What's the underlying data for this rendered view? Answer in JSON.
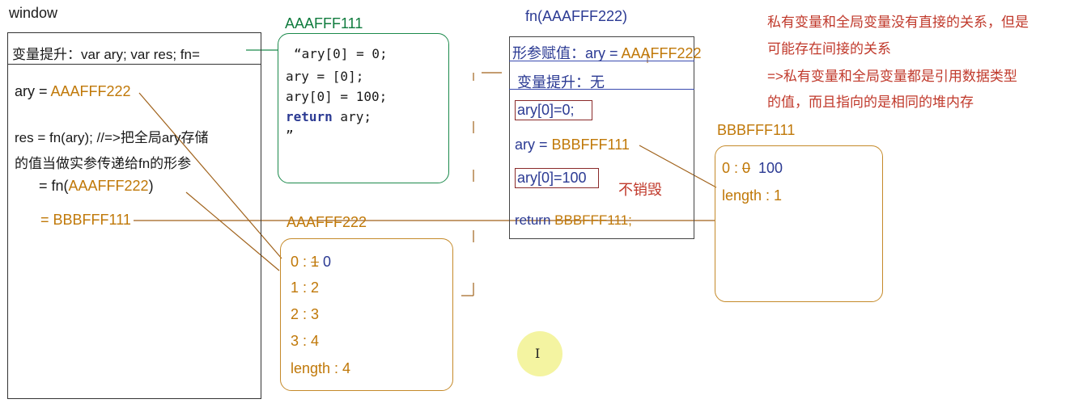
{
  "colors": {
    "orange": "#c07808",
    "blue": "#2b3a93",
    "green": "#0f7b3d",
    "red": "#c0392b",
    "line": "#a0621b"
  },
  "window": {
    "title": "window",
    "hoisting": "变量提升：var ary;  var res;  fn=",
    "ary_label": "ary = ",
    "ary_value": "AAAFFF222",
    "res_line1": "res = fn(ary); //=>把全局ary存储",
    "res_line2": "的值当做实参传递给fn的形参",
    "fn_call_prefix": "= fn(",
    "fn_call_arg": "AAAFFF222",
    "fn_call_suffix": ")",
    "result": "= BBBFFF111"
  },
  "code_heap": {
    "label": "AAAFFF111",
    "lines": [
      "“ary[0] = 0;",
      "ary = [0];",
      "ary[0] = 100;",
      "return ary;",
      "”"
    ],
    "keyword": "return"
  },
  "array_heap": {
    "label": "AAAFFF222",
    "items": [
      {
        "key": "0 : ",
        "old": "1",
        "new": " 0"
      },
      {
        "key": "1 : 2"
      },
      {
        "key": "2 : 3"
      },
      {
        "key": "3 : 4"
      },
      {
        "key": "length : 4"
      }
    ]
  },
  "fn_scope": {
    "label": "fn(AAAFFF222)",
    "param_prefix": "形参赋值：ary = ",
    "param_value": "AAAFFF222",
    "hoisting": "变量提升：无",
    "line1": "ary[0]=0;",
    "line2_prefix": "ary = ",
    "line2_value": "BBBFFF111",
    "line3": "ary[0]=100",
    "not_destroyed": "不销毁",
    "return_prefix": "return ",
    "return_value": "BBBFFF111;"
  },
  "new_heap": {
    "label": "BBBFFF111",
    "item0_key": "0 : ",
    "item0_old": "0",
    "item0_new": "  100",
    "item1": "length : 1"
  },
  "note": {
    "line1": "私有变量和全局变量没有直接的关系，但是",
    "line2": "可能存在间接的关系",
    "line3": "=>私有变量和全局变量都是引用数据类型",
    "line4": "的值，而且指向的是相同的堆内存"
  },
  "cursor_glyph": "I"
}
